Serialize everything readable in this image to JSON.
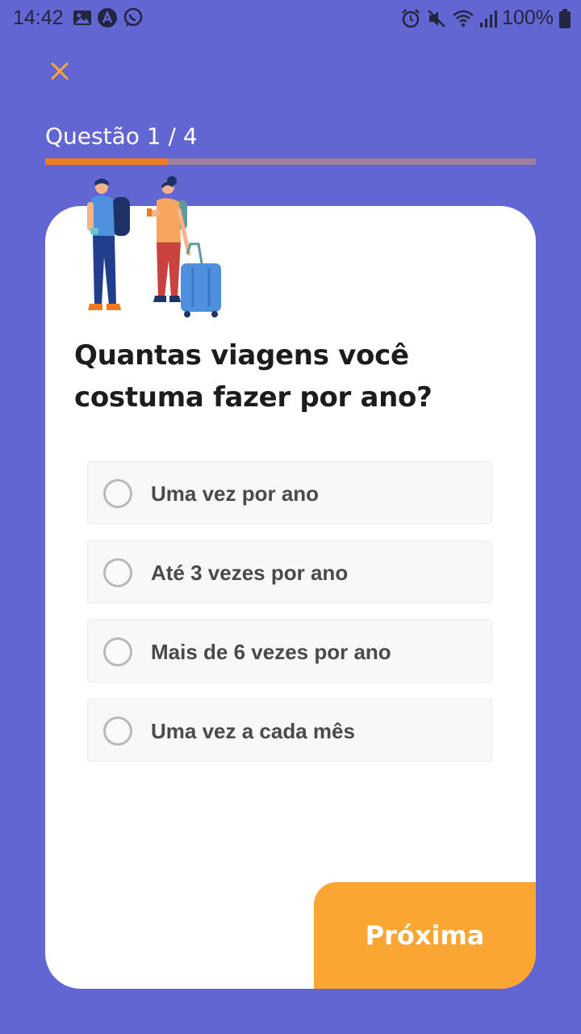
{
  "status_bar": {
    "time": "14:42",
    "battery": "100%",
    "left_icons": [
      "image-icon",
      "app-a-icon",
      "whatsapp-icon"
    ],
    "right_icons": [
      "alarm-icon",
      "mute-icon",
      "wifi-icon",
      "signal-icon",
      "battery-icon"
    ]
  },
  "quiz": {
    "counter": "Questão 1 / 4",
    "progress": 0.25,
    "question": "Quantas viagens você costuma fazer por ano?",
    "options": [
      "Uma vez por ano",
      "Até 3 vezes por ano",
      "Mais de 6 vezes por ano",
      "Uma vez a cada mês"
    ],
    "next_label": "Próxima"
  },
  "colors": {
    "background": "#6266d2",
    "accent": "#fba532",
    "progress_fill": "#f0781e",
    "close_icon": "#fba532"
  },
  "icons": {
    "close": "close-icon",
    "radio": "radio-unchecked-icon",
    "illustration": "travelers-illustration"
  }
}
